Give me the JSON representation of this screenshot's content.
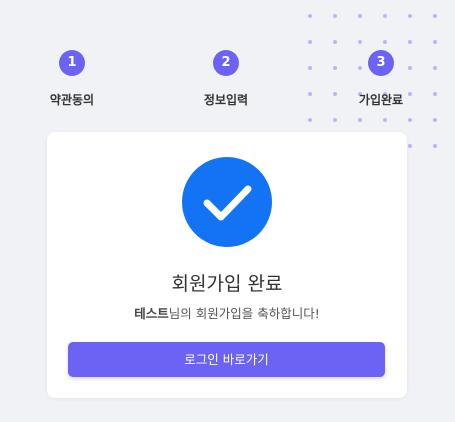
{
  "steps": [
    {
      "number": "1",
      "label": "약관동의"
    },
    {
      "number": "2",
      "label": "정보입력"
    },
    {
      "number": "3",
      "label": "가입완료"
    }
  ],
  "card": {
    "icon": "check-icon",
    "title": "회원가입 완료",
    "user_name": "테스트",
    "message_suffix": "님의 회원가입을 축하합니다!",
    "login_button": "로그인 바로가기"
  },
  "colors": {
    "accent": "#6c63f5",
    "check_blue": "#1373f5",
    "background": "#f1f2f6",
    "dot": "#b9b6f6"
  }
}
